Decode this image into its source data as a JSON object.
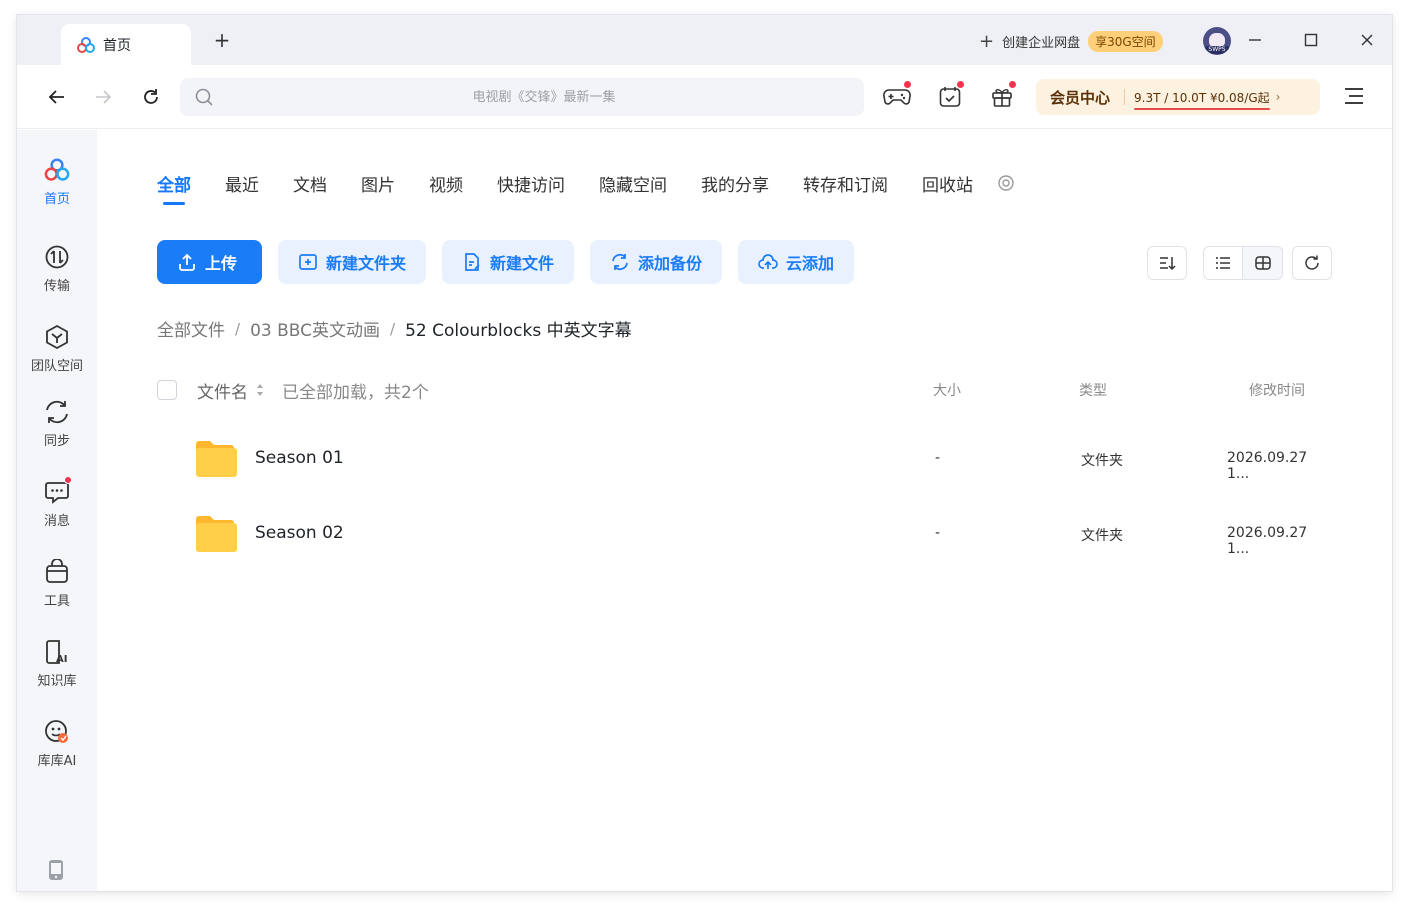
{
  "titlebar": {
    "tab_title": "首页",
    "new_tab_symbol": "+",
    "enterprise_label": "创建企业网盘",
    "enterprise_badge": "享30G空间",
    "avatar_tag": "SWPS"
  },
  "toolbar": {
    "search_placeholder": "电视剧《交锋》最新一集",
    "vip_title": "会员中心",
    "vip_info": "9.3T / 10.0T   ¥0.08/G起",
    "vip_chevron": "›",
    "icons": [
      "gamepad-icon",
      "calendar-check-icon",
      "gift-icon"
    ]
  },
  "sidebar": {
    "items": [
      {
        "label": "首页",
        "icon": "home-logo-icon",
        "active": true
      },
      {
        "label": "传输",
        "icon": "transfer-icon",
        "active": false
      },
      {
        "label": "团队空间",
        "icon": "team-space-icon",
        "active": false
      },
      {
        "label": "同步",
        "icon": "sync-icon",
        "active": false
      },
      {
        "label": "消息",
        "icon": "message-icon",
        "active": false,
        "dot": true
      },
      {
        "label": "工具",
        "icon": "toolbox-icon",
        "active": false
      },
      {
        "label": "知识库",
        "icon": "knowledge-ai-icon",
        "active": false
      },
      {
        "label": "库库AI",
        "icon": "kuku-ai-icon",
        "active": false
      }
    ]
  },
  "main": {
    "tabs": [
      {
        "label": "全部",
        "active": true
      },
      {
        "label": "最近"
      },
      {
        "label": "文档"
      },
      {
        "label": "图片"
      },
      {
        "label": "视频"
      },
      {
        "label": "快捷访问"
      },
      {
        "label": "隐藏空间"
      },
      {
        "label": "我的分享"
      },
      {
        "label": "转存和订阅"
      },
      {
        "label": "回收站"
      }
    ],
    "actions": {
      "upload": "上传",
      "new_folder": "新建文件夹",
      "new_file": "新建文件",
      "add_backup": "添加备份",
      "cloud_add": "云添加"
    },
    "breadcrumb": [
      "全部文件",
      "03 BBC英文动画",
      "52 Colourblocks 中英文字幕"
    ],
    "breadcrumb_sep": "/",
    "list_header": {
      "name": "文件名",
      "loaded_status": "已全部加载，共2个",
      "size": "大小",
      "type": "类型",
      "modified": "修改时间"
    },
    "files": [
      {
        "name": "Season 01",
        "size": "-",
        "type": "文件夹",
        "modified": "2026.09.27 1..."
      },
      {
        "name": "Season 02",
        "size": "-",
        "type": "文件夹",
        "modified": "2026.09.27 1..."
      }
    ]
  },
  "colors": {
    "accent": "#1677ff",
    "primary_button": "#1b7cf8",
    "secondary_button_bg": "#e8f1fd",
    "notification_dot": "#f5334f",
    "vip_bg": "#fdf1e0",
    "folder_yellow": "#ffc940"
  }
}
